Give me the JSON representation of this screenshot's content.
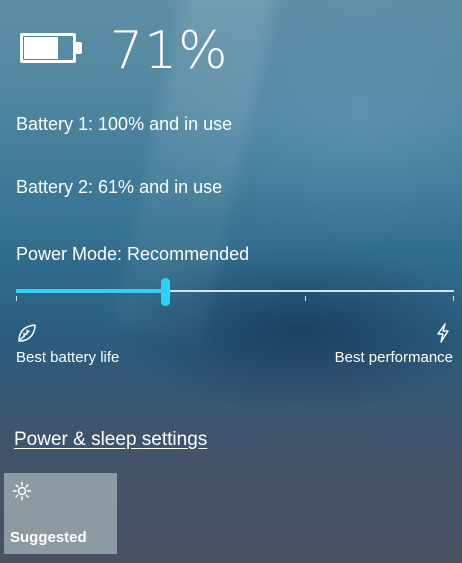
{
  "battery": {
    "percent_text": "71%",
    "level": 0.71
  },
  "batteries": [
    {
      "label": "Battery 1: 100% and in use"
    },
    {
      "label": "Battery 2: 61% and in use"
    }
  ],
  "power_mode": {
    "title": "Power Mode: Recommended",
    "slider_value": 0.34,
    "tick_positions": [
      0,
      0.34,
      0.66,
      1
    ],
    "left_label": "Best battery life",
    "right_label": "Best performance",
    "left_icon": "leaf-icon",
    "right_icon": "lightning-icon"
  },
  "settings_link": "Power & sleep settings",
  "quick_action": {
    "label": "Suggested",
    "icon": "brightness-icon"
  },
  "colors": {
    "slider_accent": "#30d0f8",
    "tile_background": "#8c9aa2"
  }
}
